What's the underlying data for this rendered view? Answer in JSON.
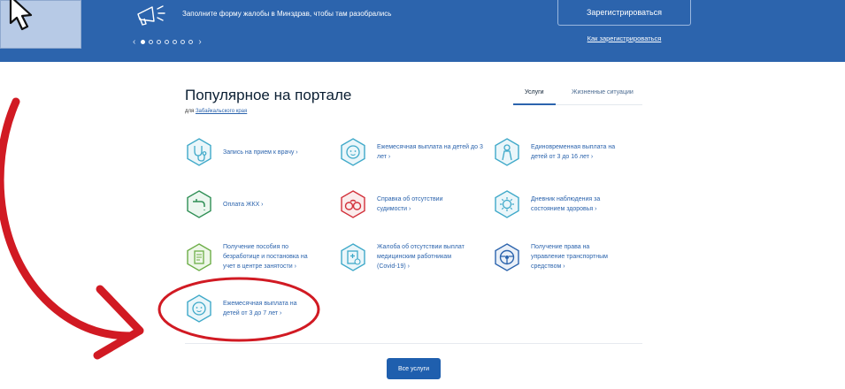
{
  "banner": {
    "text": "Заполните форму жалобы в Минздрав, чтобы там разобрались",
    "register_label": "Зарегистрироваться",
    "how_to_register": "Как зарегистрироваться",
    "prev_arrow": "‹",
    "next_arrow": "›",
    "slide_count": 7,
    "active_slide": 1
  },
  "content": {
    "title": "Популярное на портале",
    "region_prefix": "для",
    "region_link": "Забайкальского края",
    "tabs": [
      {
        "label": "Услуги",
        "active": true
      },
      {
        "label": "Жизненные ситуации",
        "active": false
      }
    ],
    "services": [
      {
        "label": "Запись на прием к врачу ›",
        "icon": "stethoscope-icon"
      },
      {
        "label": "Ежемесячная выплата на детей до 3 лет ›",
        "icon": "baby-icon"
      },
      {
        "label": "Единовременная выплата на детей от 3 до 16 лет ›",
        "icon": "child-icon"
      },
      {
        "label": "Оплата ЖКХ ›",
        "icon": "faucet-icon"
      },
      {
        "label": "Справка об отсутствии судимости ›",
        "icon": "handcuffs-icon"
      },
      {
        "label": "Дневник наблюдения за состоянием здоровья ›",
        "icon": "virus-icon"
      },
      {
        "label": "Получение пособия по безработице и постановка на учет в центре занятости ›",
        "icon": "document-icon"
      },
      {
        "label": "Жалоба об отсутствии выплат медицинским работникам (Covid-19) ›",
        "icon": "medical-document-icon"
      },
      {
        "label": "Получение права на управление транспортным средством ›",
        "icon": "steering-wheel-icon"
      },
      {
        "label": "Ежемесячная выплата на детей от 3 до 7 лет ›",
        "icon": "baby-icon"
      }
    ],
    "all_services_label": "Все услуги"
  },
  "colors": {
    "banner_blue": "#2c64ad",
    "link_blue": "#2c64ad",
    "teal_icon": "#3fa9c9",
    "green_icon": "#2f8f55",
    "red_icon": "#d2303a",
    "annotation_red": "#d11a23"
  }
}
